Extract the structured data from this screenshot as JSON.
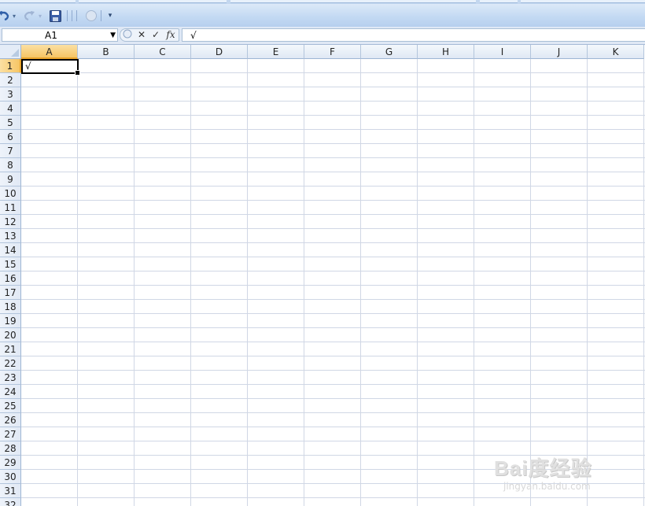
{
  "quick_access": {
    "undo_icon": "undo-arrow",
    "redo_icon": "redo-arrow",
    "save_icon": "floppy-disk",
    "customize_icon": "dropdown-arrow"
  },
  "formula_bar": {
    "name_box": "A1",
    "cancel_symbol": "✕",
    "enter_symbol": "✓",
    "function_symbol": "fx",
    "formula_value": "√"
  },
  "sheet": {
    "columns": [
      "A",
      "B",
      "C",
      "D",
      "E",
      "F",
      "G",
      "H",
      "I",
      "J",
      "K"
    ],
    "rows": [
      "1",
      "2",
      "3",
      "4",
      "5",
      "6",
      "7",
      "8",
      "9",
      "10",
      "11",
      "12",
      "13",
      "14",
      "15",
      "16",
      "17",
      "18",
      "19",
      "20",
      "21",
      "22",
      "23",
      "24",
      "25",
      "26",
      "27",
      "28",
      "29",
      "30",
      "31",
      "32"
    ],
    "selected_column": "A",
    "selected_row": "1",
    "active_cell_value": "√"
  },
  "watermark": {
    "brand": "Bai度经验",
    "url": "jingyan.baidu.com"
  }
}
